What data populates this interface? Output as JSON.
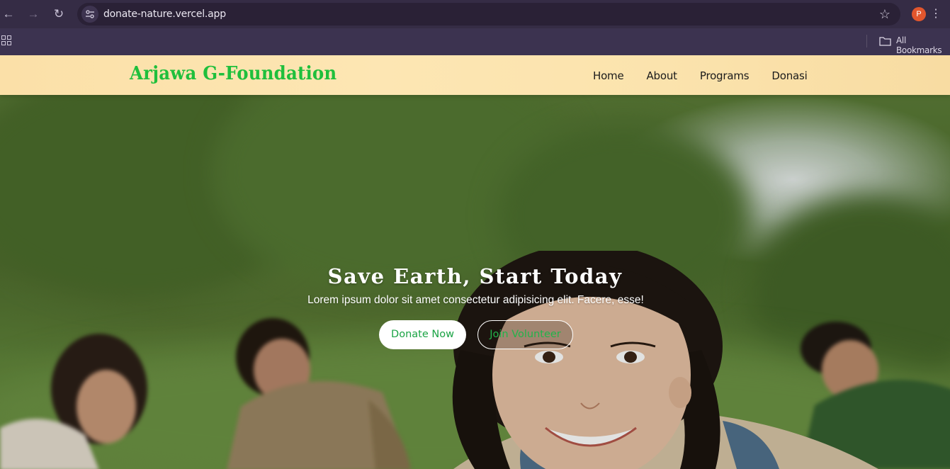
{
  "browser": {
    "back_icon": "arrow-left-icon",
    "forward_icon": "arrow-right-icon",
    "reload_icon": "reload-icon",
    "url": "donate-nature.vercel.app",
    "profile_initial": "P",
    "bookmarks_label": "All Bookmarks"
  },
  "site": {
    "brand": "Arjawa G-Foundation",
    "brand_color": "#1fbf3c",
    "nav": [
      {
        "label": "Home"
      },
      {
        "label": "About"
      },
      {
        "label": "Programs"
      },
      {
        "label": "Donasi"
      }
    ]
  },
  "hero": {
    "title": "Save Earth, Start Today",
    "subtitle": "Lorem ipsum dolor sit amet consectetur adipisicing elit. Facere, esse!",
    "primary_button": "Donate Now",
    "secondary_button": "Join Volunteer",
    "accent_color": "#1aa344"
  }
}
